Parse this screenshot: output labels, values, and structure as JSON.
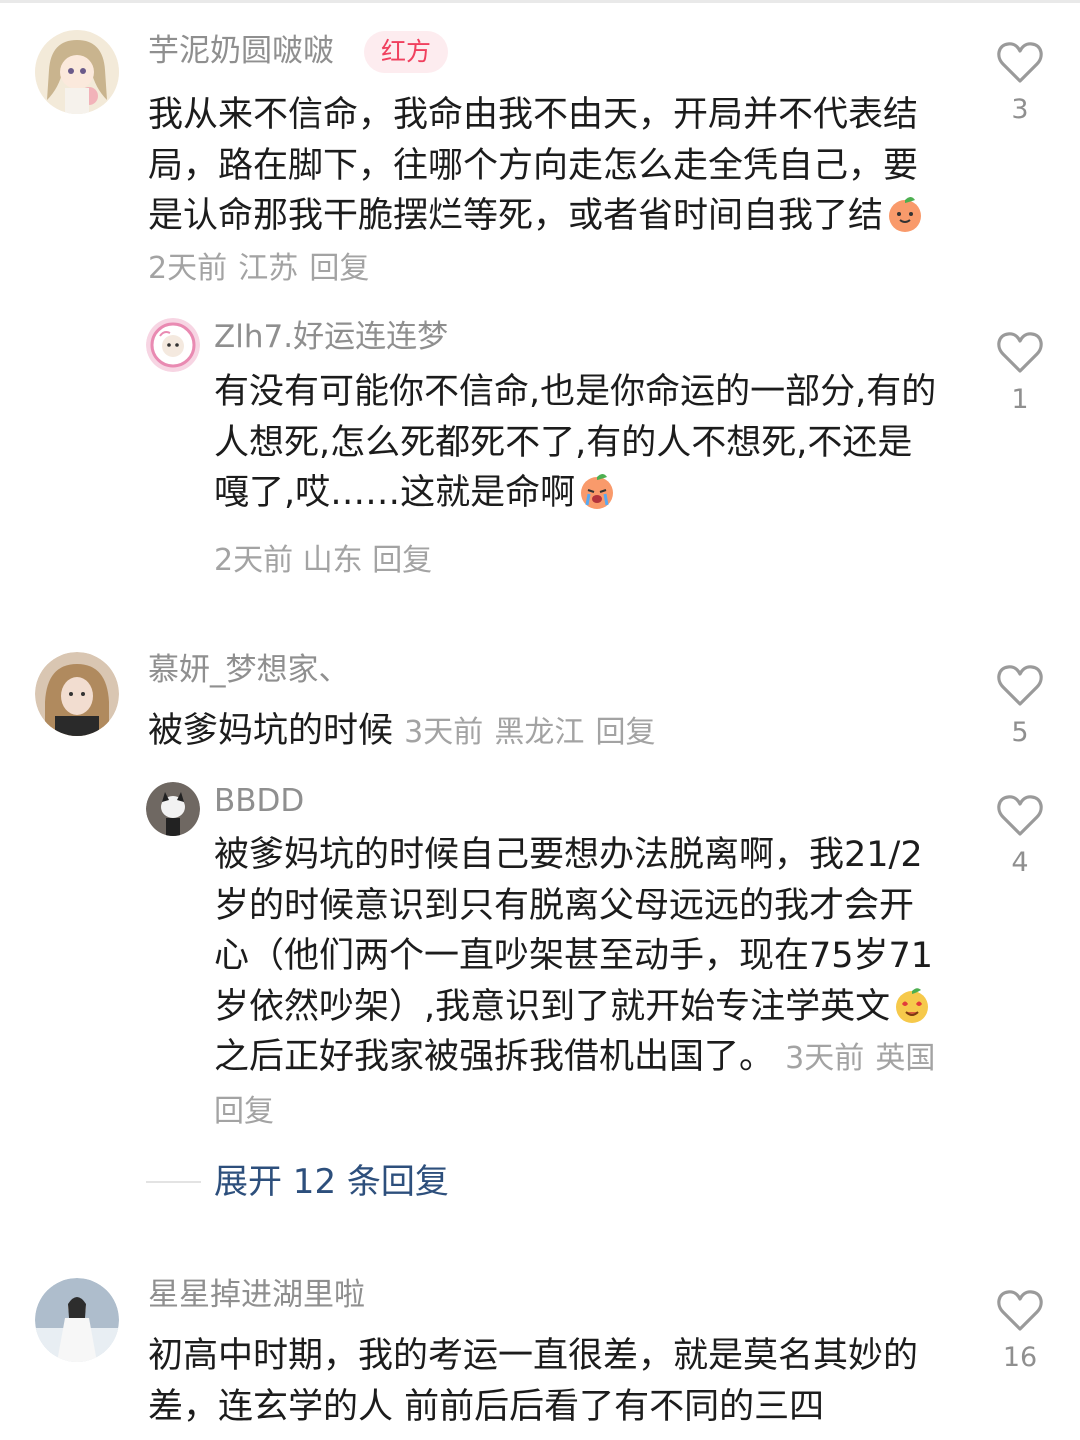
{
  "comments": [
    {
      "user": "芋泥奶圆啵啵",
      "tag": "红方",
      "text": "我从来不信命，我命由我不由天，开局并不代表结局，路在脚下，往哪个方向走怎么走全凭自己，要是认命那我干脆摆烂等死，或者省时间自我了结",
      "emoji": "peach-smile-emoji",
      "time": "2天前",
      "location": "江苏",
      "reply_label": "回复",
      "likes": "3"
    },
    {
      "user": "Zlh7.好运连连梦",
      "text": "有没有可能你不信命,也是你命运的一部分,有的人想死,怎么死都死不了,有的人不想死,不还是嘎了,哎……这就是命啊",
      "emoji": "peach-cry-emoji",
      "time": "2天前",
      "location": "山东",
      "reply_label": "回复",
      "likes": "1"
    },
    {
      "user": "慕妍_梦想家、",
      "text": "被爹妈坑的时候",
      "time": "3天前",
      "location": "黑龙江",
      "reply_label": "回复",
      "likes": "5"
    },
    {
      "user": "BBDD",
      "text1": "被爹妈坑的时候自己要想办法脱离啊，我21/2岁的时候意识到只有脱离父母远远的我才会开心（他们两个一直吵架甚至动手，现在75岁71岁依然吵架）,我意识到了就开始专注学英文",
      "emoji": "heart-eyes-emoji",
      "text2": "之后正好我家被强拆我借机出国了。",
      "time": "3天前",
      "location": "英国",
      "reply_label": "回复",
      "likes": "4"
    },
    {
      "user": "星星掉进湖里啦",
      "text": "初高中时期，我的考运一直很差，就是莫名其妙的差，连玄学的人 前前后后看了有不同的三四",
      "likes": "16"
    }
  ],
  "expand_replies": "展开 12 条回复",
  "colors": {
    "tag_bg": "#fdecef",
    "tag_text": "#f0405e",
    "link": "#2d4f7c",
    "muted": "#a3a3a3"
  }
}
